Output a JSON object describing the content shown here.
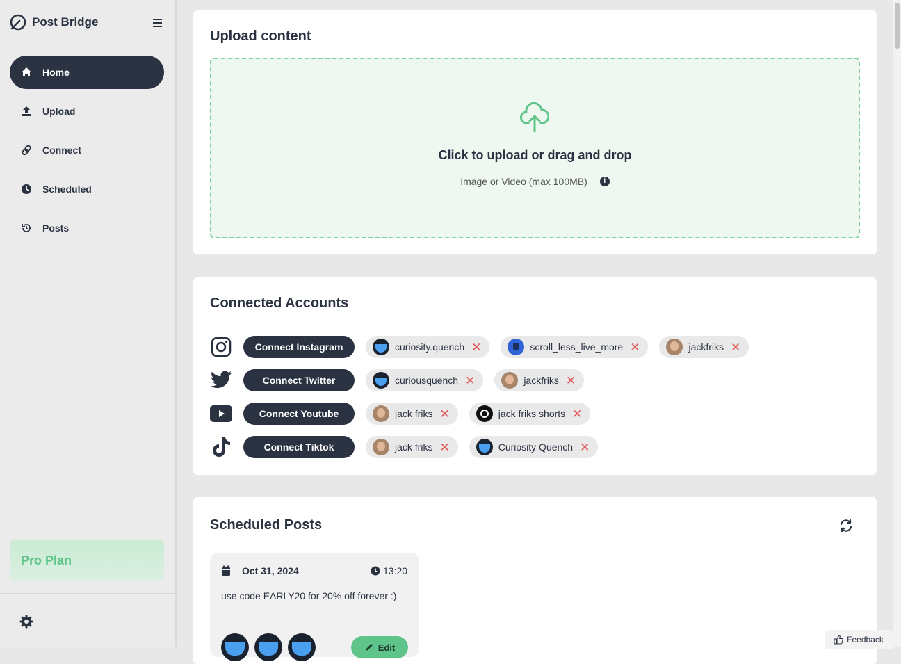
{
  "app": {
    "name": "Post Bridge"
  },
  "sidebar": {
    "items": [
      {
        "label": "Home",
        "icon": "home-icon",
        "active": true
      },
      {
        "label": "Upload",
        "icon": "upload-icon",
        "active": false
      },
      {
        "label": "Connect",
        "icon": "link-icon",
        "active": false
      },
      {
        "label": "Scheduled",
        "icon": "clock-icon",
        "active": false
      },
      {
        "label": "Posts",
        "icon": "history-icon",
        "active": false
      }
    ],
    "plan": "Pro Plan"
  },
  "upload": {
    "title": "Upload content",
    "prompt": "Click to upload or drag and drop",
    "hint": "Image or Video (max 100MB)"
  },
  "accounts": {
    "title": "Connected Accounts",
    "rows": [
      {
        "platform": "instagram",
        "button": "Connect Instagram",
        "accounts": [
          "curiosity.quench",
          "scroll_less_live_more",
          "jackfriks"
        ]
      },
      {
        "platform": "twitter",
        "button": "Connect Twitter",
        "accounts": [
          "curiousquench",
          "jackfriks"
        ]
      },
      {
        "platform": "youtube",
        "button": "Connect Youtube",
        "accounts": [
          "jack friks",
          "jack friks shorts"
        ]
      },
      {
        "platform": "tiktok",
        "button": "Connect Tiktok",
        "accounts": [
          "jack friks",
          "Curiosity Quench"
        ]
      }
    ]
  },
  "scheduled": {
    "title": "Scheduled Posts",
    "posts": [
      {
        "date": "Oct 31, 2024",
        "time": "13:20",
        "text": "use code EARLY20 for 20% off forever :)",
        "edit_label": "Edit"
      }
    ]
  },
  "feedback": {
    "label": "Feedback"
  },
  "colors": {
    "primary": "#2b3342",
    "accent": "#5fc48a",
    "remove": "#e25555"
  }
}
